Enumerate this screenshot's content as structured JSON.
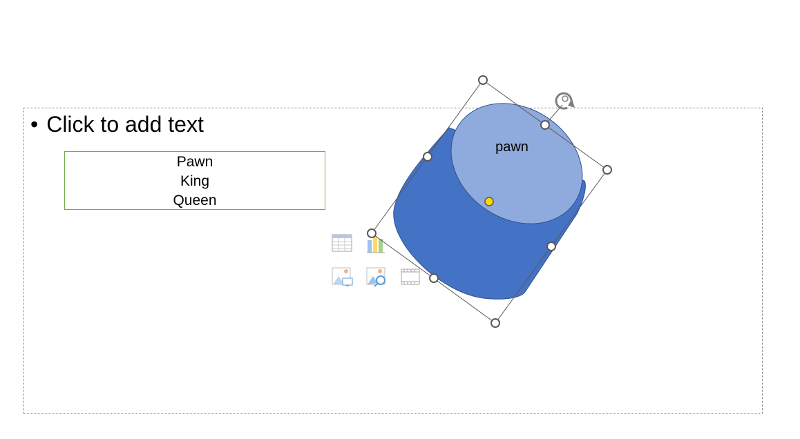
{
  "slide": {
    "content_placeholder_text": "Click to add text",
    "bullet_char": "•",
    "list_items": [
      "Pawn",
      "King",
      "Queen"
    ]
  },
  "shape": {
    "type": "cylinder",
    "label": "pawn",
    "colors": {
      "body": "#4472c4",
      "top": "#8faadc",
      "outline": "#2f528f",
      "adjust_handle": "#ffd700"
    }
  },
  "content_icons": [
    "insert-table-icon",
    "insert-chart-icon",
    "insert-picture-icon",
    "online-picture-icon",
    "insert-video-icon"
  ]
}
